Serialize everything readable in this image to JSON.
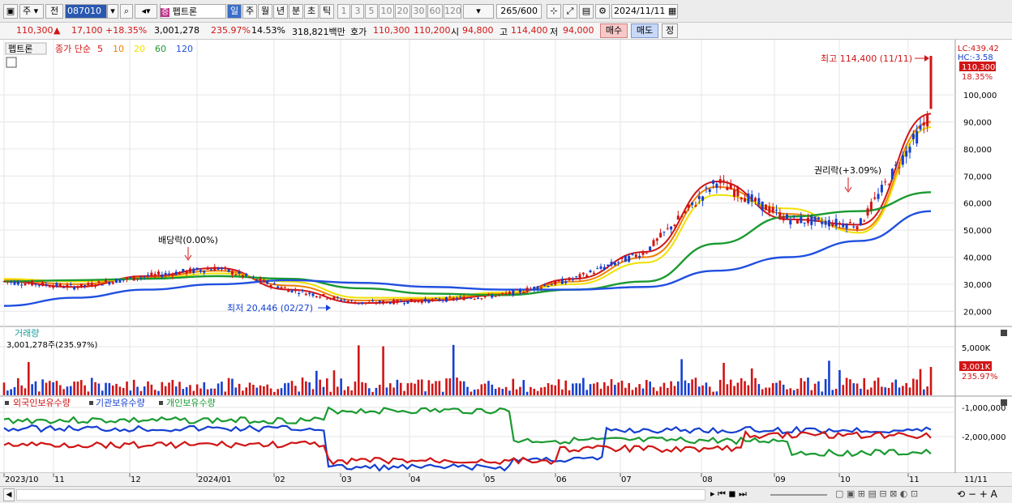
{
  "toolbar": {
    "period_label": "주",
    "type_label": "전",
    "code": "087010",
    "stock_badge": "증",
    "stock_name": "펩트론",
    "tf_buttons": [
      "일",
      "주",
      "월",
      "년",
      "분",
      "초",
      "틱"
    ],
    "interval_buttons": [
      "1",
      "3",
      "5",
      "10",
      "20",
      "30",
      "60",
      "120"
    ],
    "bar_count": "265",
    "bar_total": "/600",
    "date": "2024/11/11"
  },
  "info": {
    "price": "110,300",
    "arrow": "▲",
    "change": "17,100",
    "pct": "+18.35%",
    "volume": "3,001,278",
    "vol_pct": "235.97%",
    "turnover": "14.53%",
    "amount": "318,821백만",
    "hoga_label": "호가",
    "ask": "110,300",
    "bid": "110,200",
    "open_label": "시",
    "open": "94,800",
    "high_label": "고",
    "high": "114,400",
    "low_label": "저",
    "low": "94,000",
    "buy": "매수",
    "sell": "매도",
    "edit": "정"
  },
  "legend": {
    "name": "펩트론",
    "title": "종가 단순",
    "mas": [
      {
        "label": "5",
        "color": "#d01515"
      },
      {
        "label": "10",
        "color": "#f08000"
      },
      {
        "label": "20",
        "color": "#f0e000"
      },
      {
        "label": "60",
        "color": "#1a9a30"
      },
      {
        "label": "120",
        "color": "#2050e0"
      }
    ]
  },
  "price_axis": {
    "lc": "LC:439.42",
    "hc": "HC:-3.58",
    "current": "110,300",
    "current_pct": "18.35%",
    "ticks": [
      "100,000",
      "90,000",
      "80,000",
      "70,000",
      "60,000",
      "50,000",
      "40,000",
      "30,000",
      "20,000"
    ]
  },
  "annotations": {
    "high": "최고 114,400 (11/11)",
    "low": "최저 20,446 (02/27)",
    "div": "배당락(0.00%)",
    "rights": "권리락(+3.09%)"
  },
  "volume_panel": {
    "title": "거래량",
    "value": "3,001,278주(235.97%)",
    "tick": "5,000K",
    "current": "3,001K",
    "current_pct": "235.97%"
  },
  "holders_panel": {
    "l1": "외국인보유수량",
    "l2": "기관보유수량",
    "l3": "개인보유수량",
    "ticks": [
      "-1,000,000",
      "-2,000,000"
    ]
  },
  "x_axis": [
    "2023/10",
    "11",
    "12",
    "2024/01",
    "02",
    "03",
    "04",
    "05",
    "06",
    "07",
    "08",
    "09",
    "10",
    "11",
    "11/11"
  ],
  "chart_data": {
    "type": "line",
    "ylim": [
      15000,
      118000
    ],
    "x": [
      "2023/10",
      "11",
      "12",
      "2024/01",
      "02",
      "03",
      "04",
      "05",
      "06",
      "07",
      "08",
      "09",
      "10",
      "11"
    ],
    "series": [
      {
        "name": "5",
        "values": [
          31000,
          29000,
          33000,
          36000,
          28000,
          23000,
          24000,
          26000,
          32000,
          42000,
          68000,
          54000,
          52000,
          93000
        ]
      },
      {
        "name": "10",
        "values": [
          31500,
          30000,
          32500,
          35000,
          29500,
          24000,
          24500,
          26500,
          31000,
          40000,
          66000,
          56000,
          50000,
          90000
        ]
      },
      {
        "name": "20",
        "values": [
          32000,
          31000,
          32000,
          34000,
          31000,
          25000,
          25000,
          27000,
          30000,
          38000,
          63000,
          58000,
          49000,
          88000
        ]
      },
      {
        "name": "60",
        "values": [
          31000,
          31500,
          32000,
          33000,
          32000,
          28500,
          26500,
          26000,
          28000,
          31000,
          45000,
          55000,
          57000,
          64000
        ]
      },
      {
        "name": "120",
        "values": [
          22000,
          25000,
          28000,
          30000,
          31500,
          30500,
          29000,
          28000,
          28000,
          29000,
          35000,
          40000,
          46000,
          57000
        ]
      }
    ],
    "colors": [
      "#d01515",
      "#f08000",
      "#f0e000",
      "#1a9a30",
      "#2050e0"
    ]
  }
}
